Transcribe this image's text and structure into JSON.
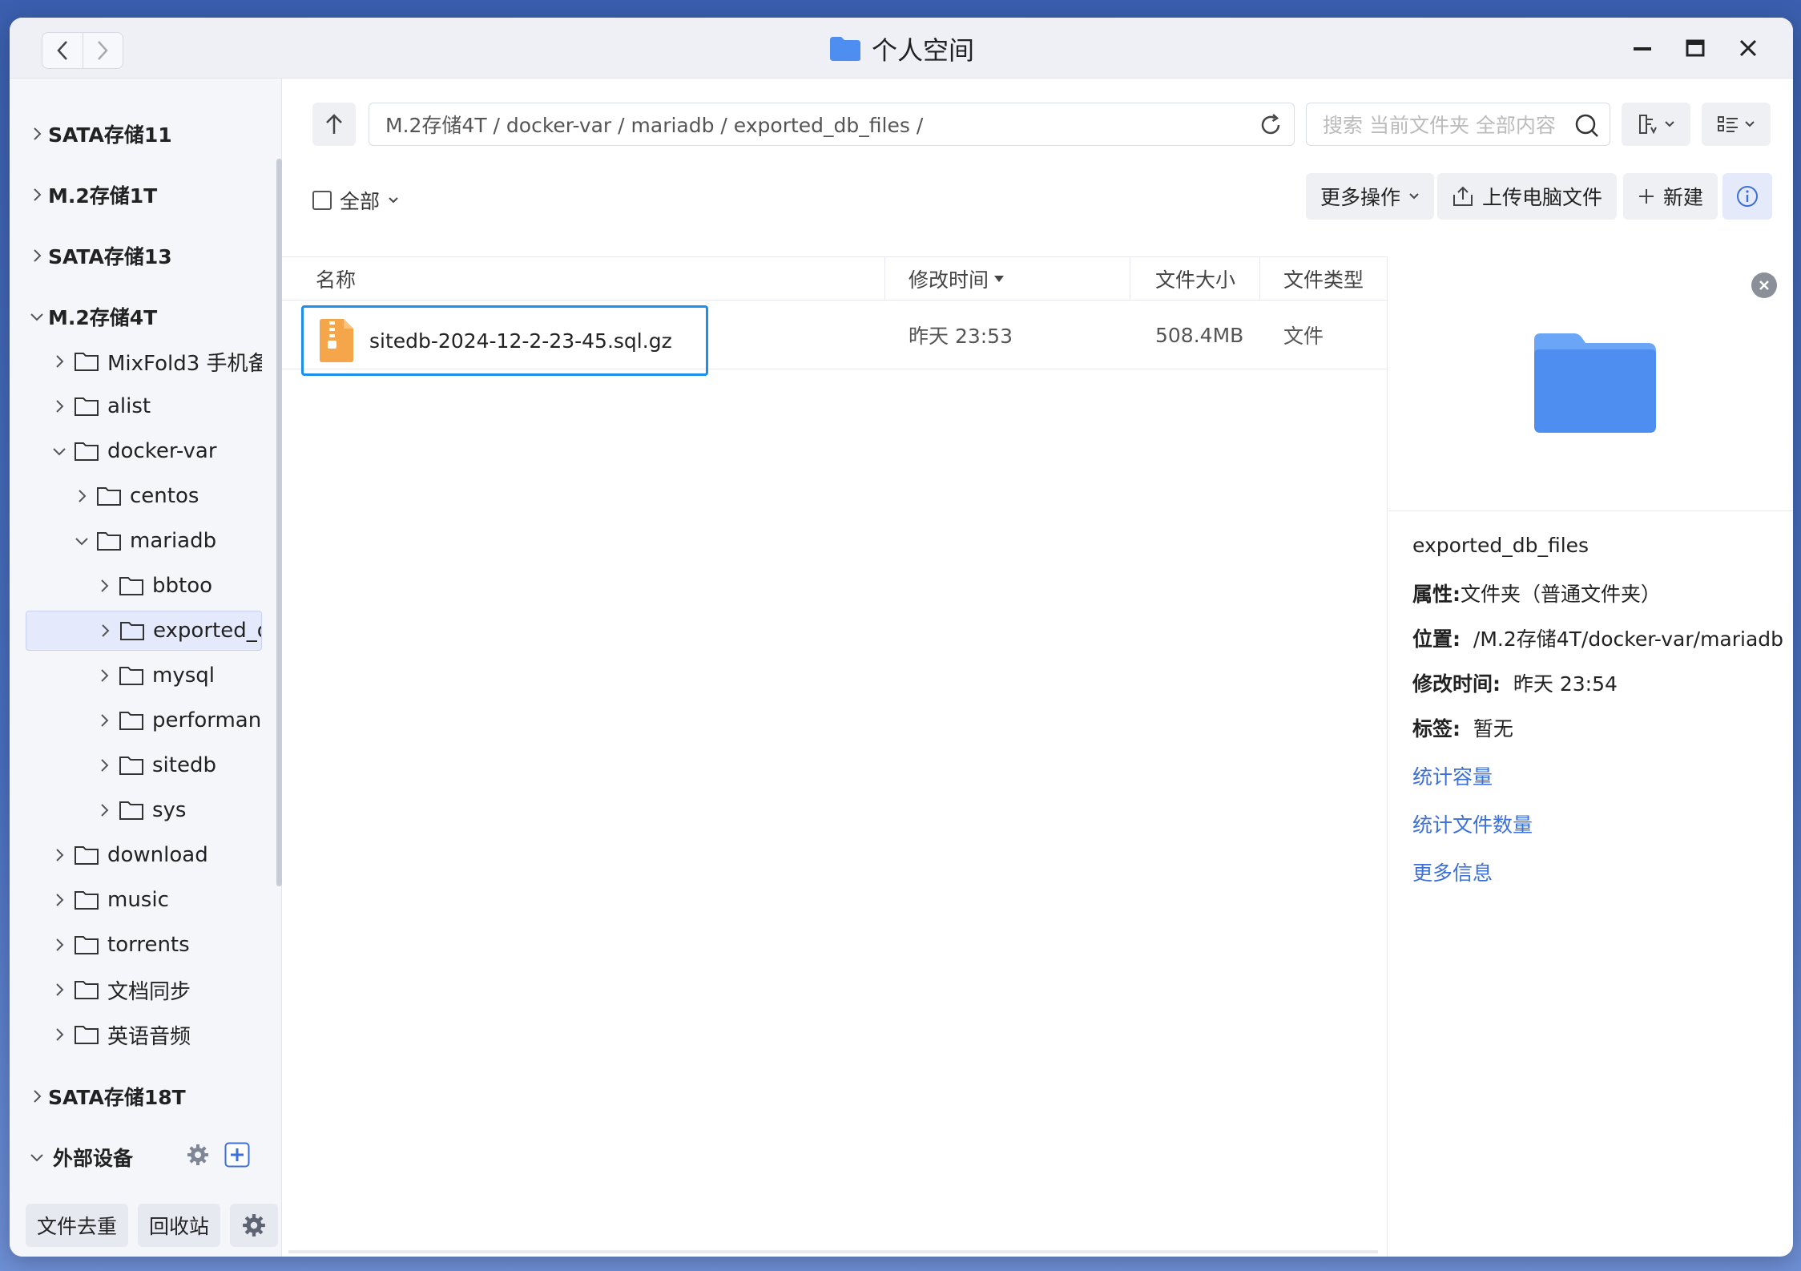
{
  "window": {
    "title": "个人空间"
  },
  "sidebar": {
    "roots": [
      {
        "label": "SATA存储11"
      },
      {
        "label": "M.2存储1T"
      },
      {
        "label": "SATA存储13"
      },
      {
        "label": "M.2存储4T"
      },
      {
        "label": "SATA存储18T"
      }
    ],
    "tree": [
      {
        "label": "MixFold3 手机备"
      },
      {
        "label": "alist"
      },
      {
        "label": "docker-var"
      },
      {
        "label": "centos"
      },
      {
        "label": "mariadb"
      },
      {
        "label": "bbtoo"
      },
      {
        "label": "exported_db_files"
      },
      {
        "label": "mysql"
      },
      {
        "label": "performance_schema"
      },
      {
        "label": "sitedb"
      },
      {
        "label": "sys"
      },
      {
        "label": "download"
      },
      {
        "label": "music"
      },
      {
        "label": "torrents"
      },
      {
        "label": "文档同步"
      },
      {
        "label": "英语音频"
      }
    ],
    "external": "外部设备",
    "footer": {
      "dedupe": "文件去重",
      "recycle": "回收站"
    }
  },
  "toolbar": {
    "path": "M.2存储4T / docker-var / mariadb / exported_db_files /",
    "search_placeholder": "搜索 当前文件夹 全部内容",
    "select_all": "全部",
    "more_actions": "更多操作",
    "upload": "上传电脑文件",
    "new": "新建"
  },
  "table": {
    "columns": {
      "name": "名称",
      "modified": "修改时间",
      "size": "文件大小",
      "type": "文件类型"
    },
    "rows": [
      {
        "name": "sitedb-2024-12-2-23-45.sql.gz",
        "modified": "昨天 23:53",
        "size": "508.4MB",
        "type": "文件"
      }
    ]
  },
  "info": {
    "name": "exported_db_files",
    "attr_label": "属性:",
    "attr_value": "文件夹（普通文件夹）",
    "location_label": "位置:",
    "location_value": "/M.2存储4T/docker-var/mariadb",
    "modified_label": "修改时间:",
    "modified_value": "昨天 23:54",
    "tags_label": "标签:",
    "tags_value": "暂无",
    "links": {
      "capacity": "统计容量",
      "file_count": "统计文件数量",
      "more": "更多信息"
    }
  },
  "colors": {
    "accent": "#3b6fd9",
    "selection_border": "#1a8fee",
    "folder": "#4d8ef0"
  }
}
